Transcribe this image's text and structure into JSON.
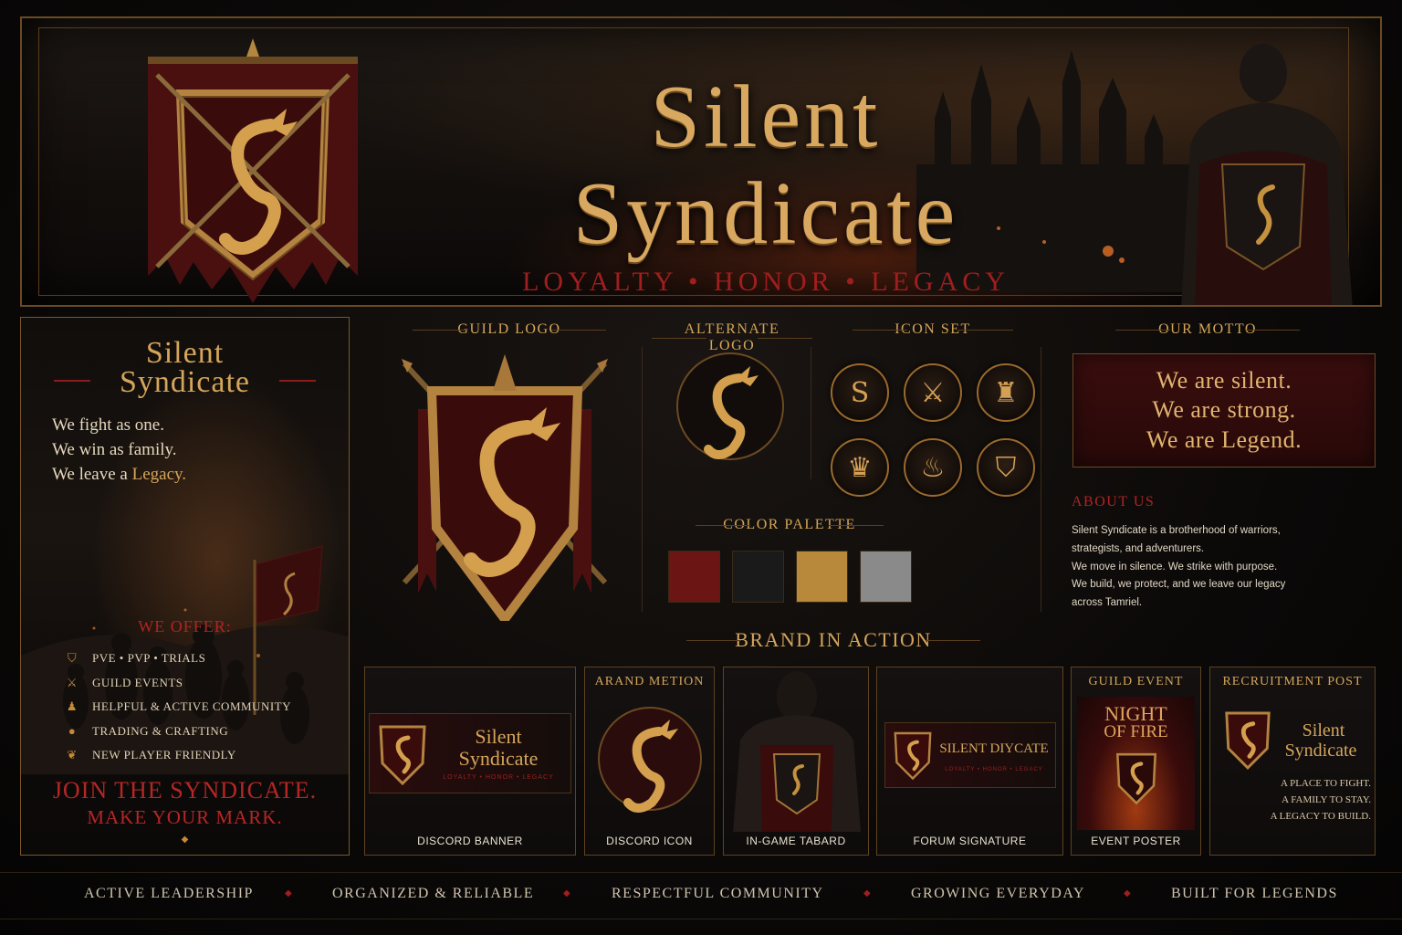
{
  "banner": {
    "title_line1": "Silent",
    "title_line2": "Syndicate",
    "tagline": "LOYALTY • HONOR • LEGACY"
  },
  "poster": {
    "title_line1": "Silent",
    "title_line2": "Syndicate",
    "lines": [
      "We fight as one.",
      "We win as family.",
      "We leave a "
    ],
    "legacy_word": "Legacy.",
    "offer_title": "WE OFFER:",
    "offers": [
      {
        "label": "PVE • PVP • TRIALS",
        "icon": "helmet-icon"
      },
      {
        "label": "GUILD EVENTS",
        "icon": "crossed-swords-icon"
      },
      {
        "label": "HELPFUL & ACTIVE COMMUNITY",
        "icon": "people-icon"
      },
      {
        "label": "TRADING & CRAFTING",
        "icon": "coins-icon"
      },
      {
        "label": "NEW PLAYER FRIENDLY",
        "icon": "sprout-icon"
      }
    ],
    "cta_line1": "JOIN THE SYNDICATE.",
    "cta_line2": "MAKE YOUR MARK."
  },
  "sections": {
    "guild_logo": "GUILD LOGO",
    "alternate_logo": "ALTERNATE LOGO",
    "icon_set": "ICON SET",
    "our_motto": "OUR MOTTO",
    "color_palette": "COLOR PALETTE",
    "brand_in_action": "BRAND IN ACTION"
  },
  "icon_set": [
    {
      "name": "dragon-icon",
      "glyph": "S"
    },
    {
      "name": "crossed-swords-icon",
      "glyph": "⚔"
    },
    {
      "name": "castle-icon",
      "glyph": "♜"
    },
    {
      "name": "crown-icon",
      "glyph": "♛"
    },
    {
      "name": "flame-icon",
      "glyph": "♨"
    },
    {
      "name": "helmet-icon",
      "glyph": "⛉"
    }
  ],
  "palette": [
    "#6b1515",
    "#1a1a1a",
    "#b8893a",
    "#8a8a8a"
  ],
  "motto": {
    "line1": "We are silent.",
    "line2": "We are strong.",
    "line3": "We are Legend."
  },
  "about": {
    "title": "ABOUT US",
    "lines": [
      "Silent Syndicate is a brotherhood of warriors,",
      "strategists, and adventurers.",
      "We move in silence. We strike with purpose.",
      "We build, we protect, and we leave our legacy",
      "across Tamriel."
    ]
  },
  "cards": {
    "discord_banner": {
      "caption": "DISCORD BANNER",
      "title1": "Silent",
      "title2": "Syndicate",
      "tagline": "LOYALTY • HONOR • LEGACY"
    },
    "discord_icon": {
      "header": "ARAND METION",
      "caption": "DISCORD ICON"
    },
    "tabard": {
      "caption": "IN-GAME TABARD"
    },
    "forum_signature": {
      "caption": "FORUM SIGNATURE",
      "title": "SILENT DIYCATE",
      "tagline": "LOYALTY • HONOR • LEGACY"
    },
    "event_poster": {
      "header": "GUILD EVENT",
      "title1": "NIGHT",
      "title2": "OF FIRE",
      "caption": "EVENT POSTER"
    },
    "recruitment": {
      "header": "RECRUITMENT POST",
      "title1": "Silent",
      "title2": "Syndicate",
      "lines": [
        "A PLACE TO FIGHT.",
        "A FAMILY TO STAY.",
        "A LEGACY TO BUILD."
      ]
    }
  },
  "footer": [
    "ACTIVE LEADERSHIP",
    "ORGANIZED & RELIABLE",
    "RESPECTFUL COMMUNITY",
    "GROWING EVERYDAY",
    "BUILT FOR LEGENDS"
  ]
}
